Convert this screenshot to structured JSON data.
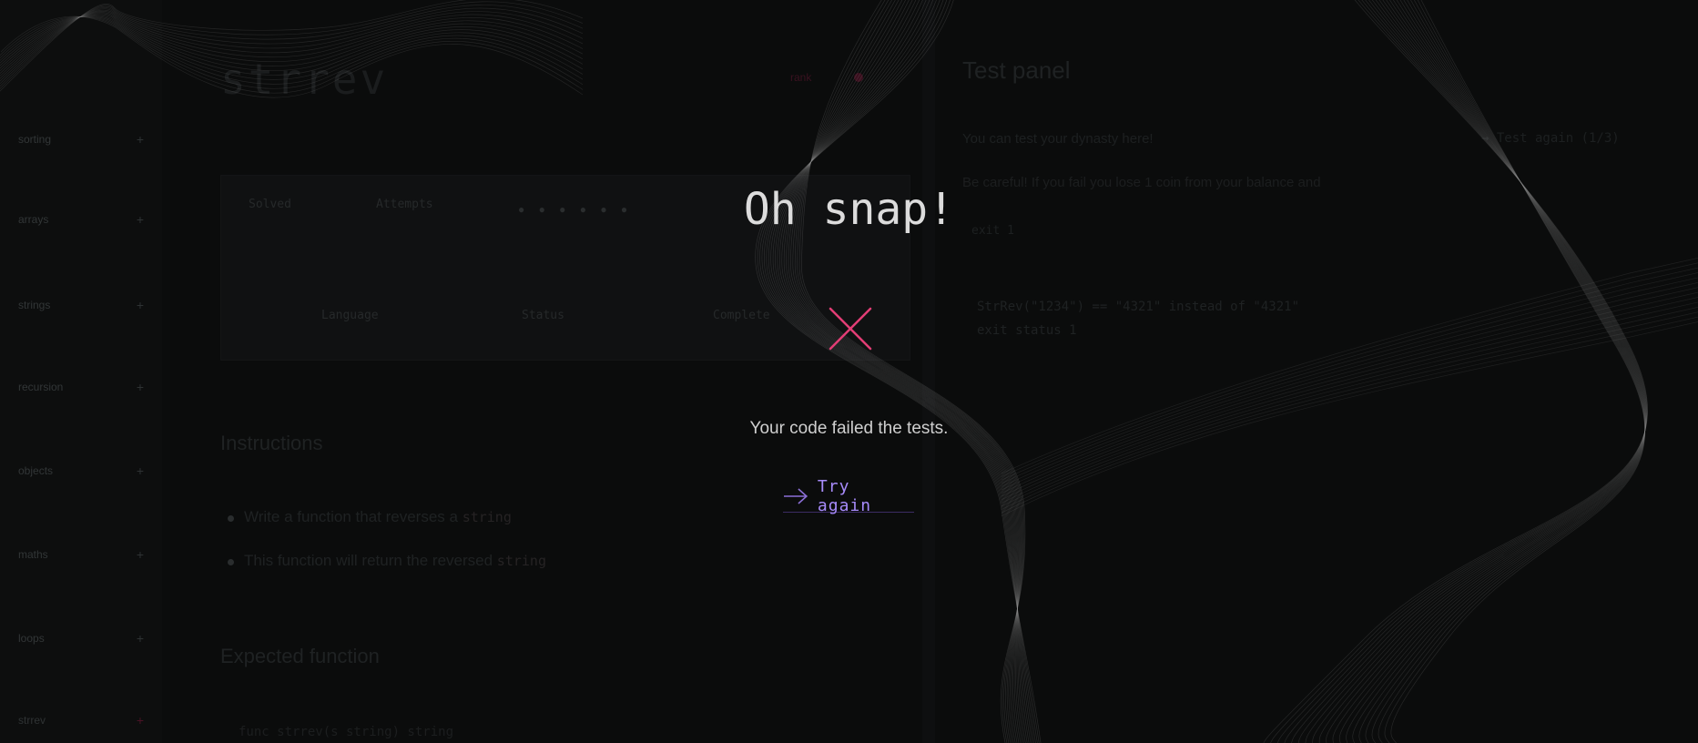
{
  "sidebar": {
    "items": [
      {
        "label": "sorting"
      },
      {
        "label": "arrays"
      },
      {
        "label": "strings"
      },
      {
        "label": "recursion"
      },
      {
        "label": "objects"
      },
      {
        "label": "maths"
      },
      {
        "label": "loops"
      },
      {
        "label": "strrev"
      }
    ],
    "expand_glyph": "+"
  },
  "kata": {
    "title": "strrev",
    "rank": "rank",
    "card": {
      "labels": [
        "Solved",
        "Attempts",
        "Language",
        "Status",
        "Complete"
      ],
      "stars": "● ● ● ● ● ●"
    },
    "instructions_heading": "Instructions",
    "instructions": [
      {
        "text": "Write a function that reverses a ",
        "code": "string"
      },
      {
        "text": "This function will return the reversed ",
        "code": "string"
      }
    ],
    "expected_heading": "Expected function",
    "expected_code": "func strrev(s string) string"
  },
  "test_panel": {
    "title": "Test panel",
    "subtitle": "You can test your dynasty here!",
    "link": "→ Test again (1/3)",
    "note": "Be careful! If you fail you lose 1 coin from your balance and",
    "tag": "exit 1",
    "code": "StrRev(\"1234\") == \"4321\" instead of \"4321\"\nexit status 1"
  },
  "modal": {
    "title": "Oh snap!",
    "message": "Your code failed the tests.",
    "retry_label": "Try again",
    "icon": "close-x-icon",
    "retry_icon": "arrow-right-icon"
  },
  "colors": {
    "background": "#0b0c0c",
    "fail_accent": "#e23d75",
    "retry_accent": "#a78bfa"
  }
}
